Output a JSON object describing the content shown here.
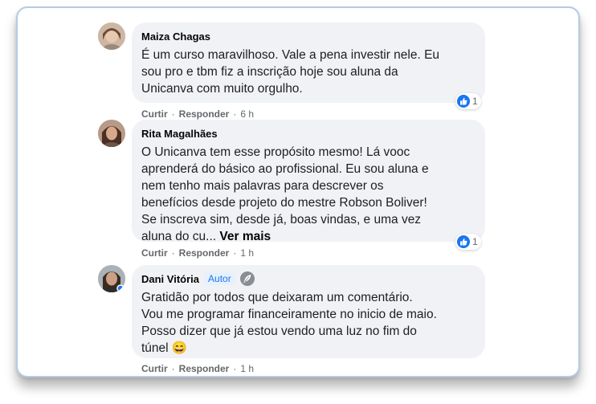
{
  "colors": {
    "accent": "#1877f2",
    "bubble": "#f0f2f5",
    "meta_text": "#65676b"
  },
  "comments": [
    {
      "author": "Maiza Chagas",
      "text": "É um curso maravilhoso. Vale a pena investir nele. Eu\nsou pro e tbm fiz a inscrição hoje sou aluna da\nUnicanva com muito orgulho.",
      "like_label": "Curtir",
      "reply_label": "Responder",
      "time": "6 h",
      "reaction_icon": "like-icon",
      "reaction_count": "1"
    },
    {
      "author": "Rita Magalhães",
      "text": "O Unicanva tem esse propósito mesmo! Lá vooc\naprenderá do básico ao profissional. Eu sou aluna e\nnem tenho mais palavras para descrever os\nbenefícios desde projeto do mestre Robson Boliver!\nSe inscreva sim, desde já, boas vindas, e uma vez\naluna do cu... ",
      "see_more": "Ver mais",
      "like_label": "Curtir",
      "reply_label": "Responder",
      "time": "1 h",
      "reaction_icon": "like-icon",
      "reaction_count": "1"
    },
    {
      "author": "Dani Vitória",
      "badge": "Autor",
      "badge_icon": "feather-icon",
      "text": "Gratidão por todos que deixaram um comentário.\nVou me programar financeiramente no inicio de maio.\nPosso dizer que já estou vendo uma luz no fim do\ntúnel ",
      "emoji": "😄",
      "like_label": "Curtir",
      "reply_label": "Responder",
      "time": "1 h"
    }
  ]
}
